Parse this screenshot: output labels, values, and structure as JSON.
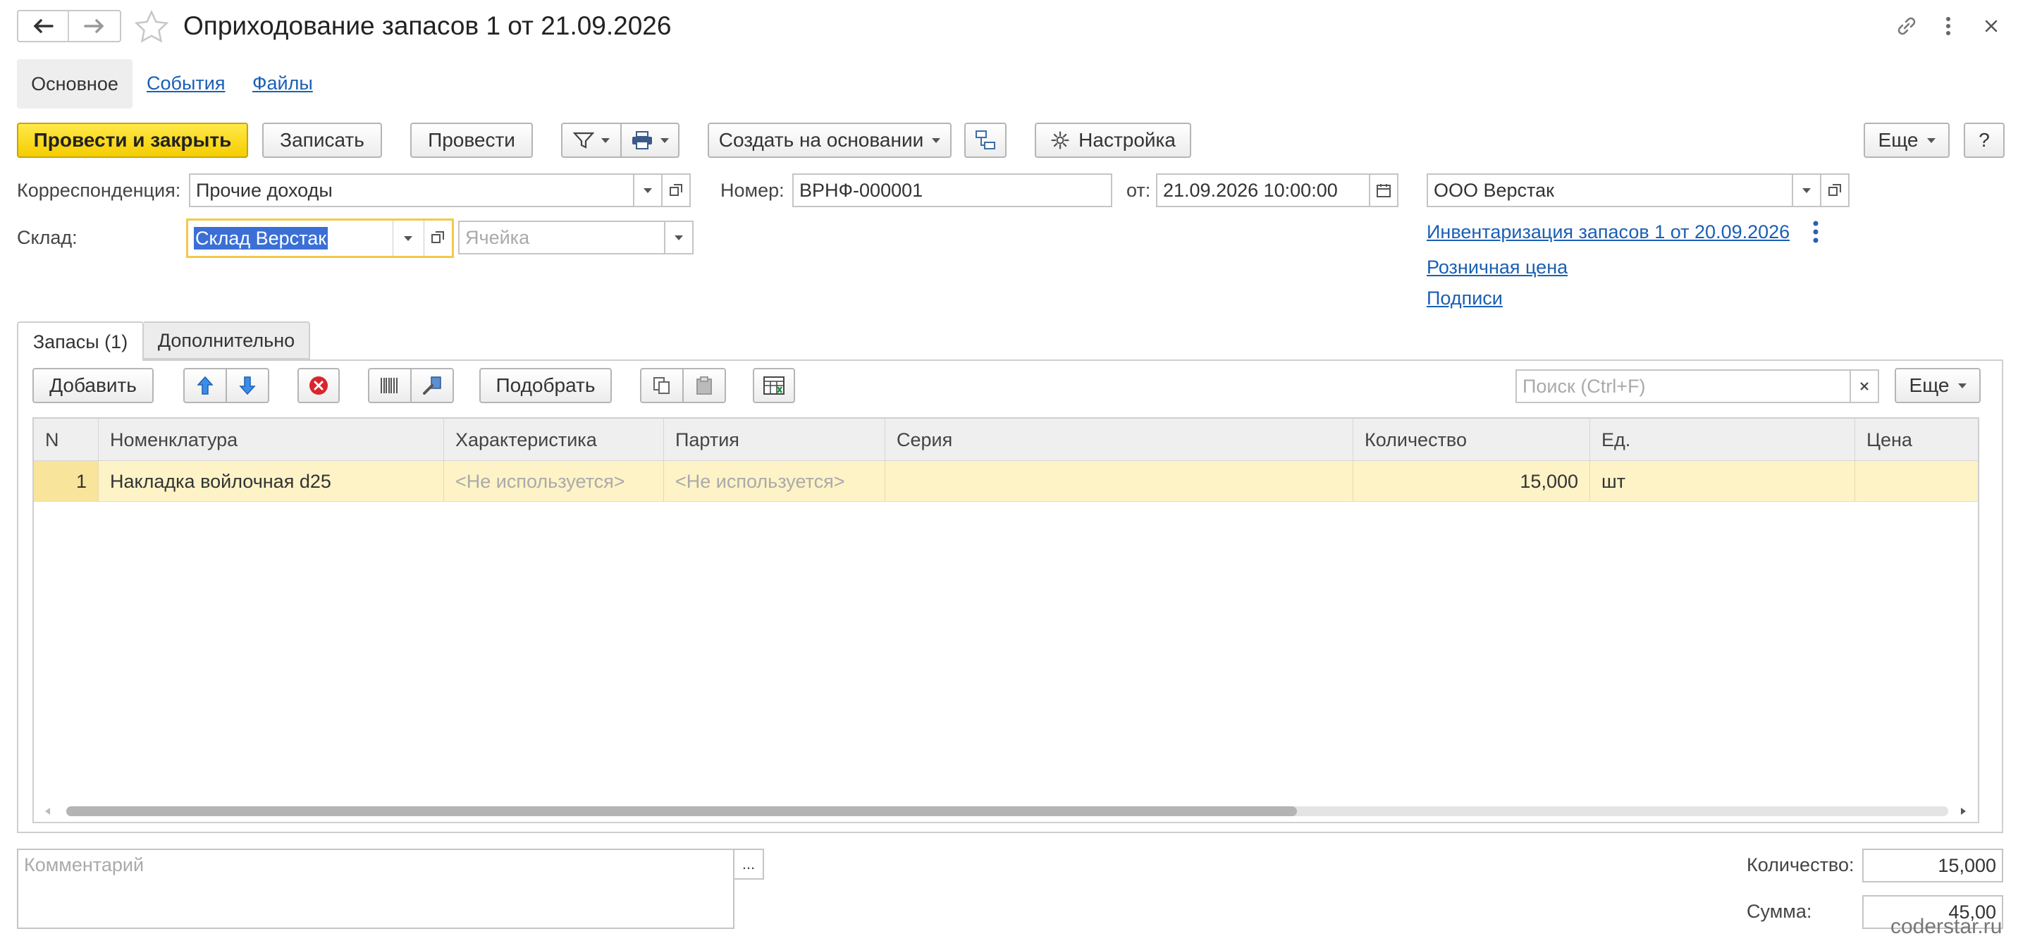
{
  "header": {
    "title": "Оприходование запасов 1 от 21.09.2026"
  },
  "tabs_top": [
    "Основное",
    "События",
    "Файлы"
  ],
  "toolbar": {
    "post_close": "Провести и закрыть",
    "save": "Записать",
    "post": "Провести",
    "create_based": "Создать на основании",
    "settings": "Настройка",
    "more": "Еще",
    "help": "?"
  },
  "form": {
    "corr_label": "Корреспонденция:",
    "corr_value": "Прочие доходы",
    "number_label": "Номер:",
    "number_value": "ВРНФ-000001",
    "date_label": "от:",
    "date_value": "21.09.2026 10:00:00",
    "org_value": "ООО Верстак",
    "warehouse_label": "Склад:",
    "warehouse_value": "Склад Верстак",
    "cell_placeholder": "Ячейка",
    "link_inventory": "Инвентаризация запасов 1 от 20.09.2026",
    "link_retail": "Розничная цена",
    "link_signatures": "Подписи"
  },
  "tabs_inner": [
    "Запасы (1)",
    "Дополнительно"
  ],
  "table_toolbar": {
    "add": "Добавить",
    "pick": "Подобрать",
    "search_placeholder": "Поиск (Ctrl+F)",
    "more": "Еще"
  },
  "table": {
    "columns": [
      "N",
      "Номенклатура",
      "Характеристика",
      "Партия",
      "Серия",
      "Количество",
      "Ед.",
      "Цена"
    ],
    "rows": [
      [
        "1",
        "Накладка войлочная d25",
        "<Не используется>",
        "<Не используется>",
        "",
        "15,000",
        "шт",
        ""
      ]
    ]
  },
  "footer": {
    "comment_placeholder": "Комментарий",
    "comment_btn": "...",
    "qty_label": "Количество:",
    "qty_value": "15,000",
    "sum_label": "Сумма:",
    "sum_value": "45,00"
  },
  "watermark": "coderstar.ru",
  "colors": {
    "accent_yellow": "#f5cd00",
    "link_blue": "#1a5fb4",
    "row_highlight": "#fdf3c7",
    "focus_border": "#f2c94c"
  }
}
